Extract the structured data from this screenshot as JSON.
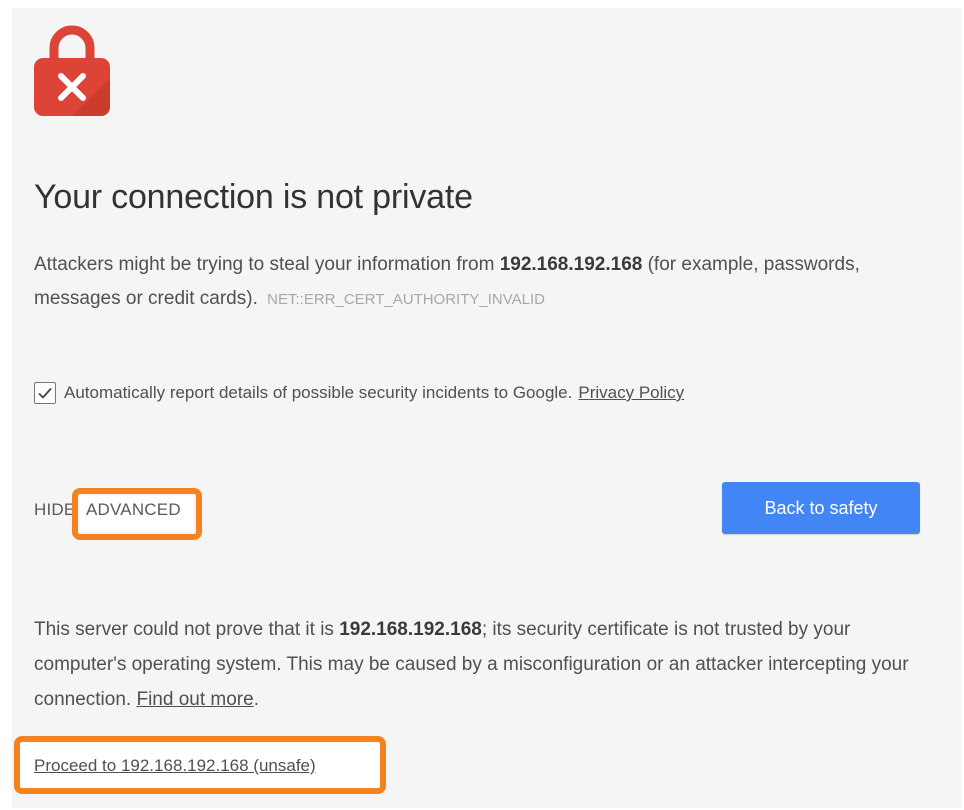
{
  "header": {
    "title": "Your connection is not private"
  },
  "message": {
    "prefix": "Attackers might be trying to steal your information from ",
    "host": "192.168.192.168",
    "suffix": " (for example, passwords, messages or credit cards).",
    "error_code": "NET::ERR_CERT_AUTHORITY_INVALID"
  },
  "report": {
    "checked": true,
    "label": "Automatically report details of possible security incidents to Google.",
    "privacy_link": "Privacy Policy"
  },
  "advanced": {
    "hide_prefix": "HIDE",
    "hide_suffix": "ADVANCED"
  },
  "back_button": {
    "label": "Back to safety"
  },
  "details": {
    "prefix": "This server could not prove that it is ",
    "host": "192.168.192.168",
    "middle": "; its security certificate is not trusted by your computer's operating system. This may be caused by a misconfiguration or an attacker intercepting your connection. ",
    "find_out_more": "Find out more",
    "end": "."
  },
  "proceed": {
    "label": "Proceed to 192.168.192.168 (unsafe)"
  },
  "colors": {
    "lock_red": "#db4437",
    "primary_button": "#4285f4",
    "highlight": "#f58220"
  }
}
